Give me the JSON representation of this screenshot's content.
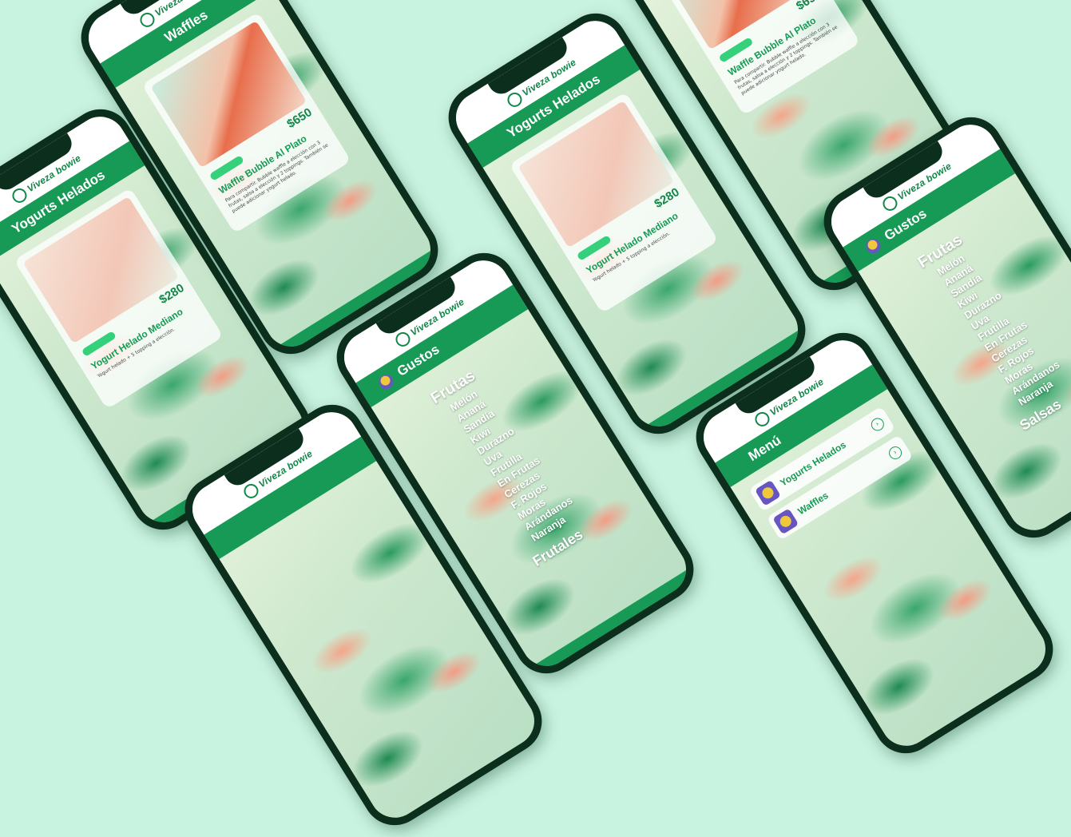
{
  "brand": {
    "logo_text": "Viveza bowie",
    "accent": "#179a55",
    "background": "#c9f3e1"
  },
  "screens": {
    "yogurt": {
      "title": "Yogurts Helados",
      "product": "Yogurt Helado Mediano",
      "description": "Yogurt helado + 5 topping a elección.",
      "price": "$280"
    },
    "waffle": {
      "title": "Waffles",
      "product": "Waffle Bubble Al Plato",
      "description": "Para compartir. Bubble waffle a elección con 3 frutas, salsa a elección y 2 toppings. También se puede adicionar yogurt helado.",
      "price": "$650"
    },
    "gustos": {
      "title": "Gustos",
      "heading": "Frutas",
      "items": [
        "Melón",
        "Ananá",
        "Sandía",
        "Kiwi",
        "Durazno",
        "Uva",
        "Frutilla",
        "En Frutas",
        "Cerezas",
        "F. Rojos",
        "Moras",
        "Arándanos",
        "Naranja"
      ],
      "heading2": "Frutales",
      "heading3": "Salsas"
    },
    "menu": {
      "title": "Menú",
      "items": [
        "Yogurts Helados",
        "Waffles"
      ]
    }
  }
}
